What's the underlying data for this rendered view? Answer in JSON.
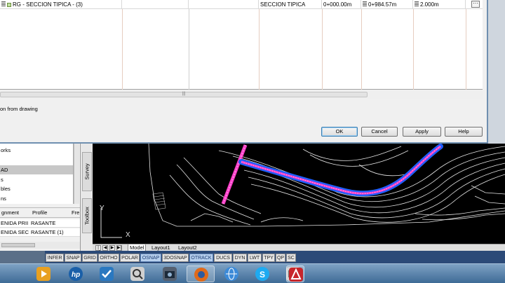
{
  "dialog": {
    "grid": {
      "row1": {
        "name": "RG - SECCION TIPICA - (3)",
        "section": "SECCION TIPICA",
        "start": "0+000.00m",
        "end": "0+984.57m",
        "increment": "2.000m"
      }
    },
    "scroll_grip": "|||",
    "checkbox_label": "on from drawing",
    "buttons": {
      "ok": "OK",
      "cancel": "Cancel",
      "apply": "Apply",
      "help": "Help"
    }
  },
  "palette": {
    "tree_items": [
      "orks",
      "AD",
      "s",
      "bles",
      "ns"
    ],
    "tabs": {
      "survey": "Survey",
      "toolbox": "Toolbox"
    },
    "list_headers": [
      "gnment",
      "Profile",
      "Fre"
    ],
    "list_rows": [
      {
        "alignment": "ENIDA PRII",
        "profile": "RASANTE"
      },
      {
        "alignment": "ENIDA SEC",
        "profile": "RASANTE (1)"
      }
    ]
  },
  "drawing": {
    "ucs_y": "Y",
    "ucs_x": "X",
    "layout_tabs": [
      "Model",
      "Layout1",
      "Layout2"
    ],
    "nav_buttons": [
      "|◀",
      "◀",
      "▶",
      "▶|"
    ]
  },
  "status": {
    "left_text": "",
    "buttons": [
      {
        "label": "INFER",
        "on": false
      },
      {
        "label": "SNAP",
        "on": false
      },
      {
        "label": "GRID",
        "on": false
      },
      {
        "label": "ORTHO",
        "on": false
      },
      {
        "label": "POLAR",
        "on": false
      },
      {
        "label": "OSNAP",
        "on": true
      },
      {
        "label": "3DOSNAP",
        "on": false
      },
      {
        "label": "OTRACK",
        "on": true
      },
      {
        "label": "DUCS",
        "on": false
      },
      {
        "label": "DYN",
        "on": false
      },
      {
        "label": "LWT",
        "on": false
      },
      {
        "label": "TPY",
        "on": false
      },
      {
        "label": "QP",
        "on": false
      },
      {
        "label": "SC",
        "on": false
      }
    ]
  },
  "taskbar": {
    "apps": [
      {
        "name": "media-player-icon",
        "color": "#e8a020"
      },
      {
        "name": "hp-icon",
        "color": "#1a5fa8"
      },
      {
        "name": "check-app-icon",
        "color": "#2a78c0"
      },
      {
        "name": "magnifier-app-icon",
        "color": "#d0d0d0"
      },
      {
        "name": "camera-app-icon",
        "color": "#556070"
      },
      {
        "name": "firefox-icon",
        "color": "#e06a1a"
      },
      {
        "name": "globe-app-icon",
        "color": "#3c8ad8"
      },
      {
        "name": "skype-icon",
        "color": "#1eaaf1"
      },
      {
        "name": "video-app-icon",
        "color": "#c8c8c8"
      },
      {
        "name": "autocad-icon",
        "color": "#c8262b"
      }
    ]
  },
  "colors": {
    "alignment_blue": "#1f5fff",
    "alignment_magenta": "#ff3cc8",
    "contour": "#e8e8e8"
  }
}
